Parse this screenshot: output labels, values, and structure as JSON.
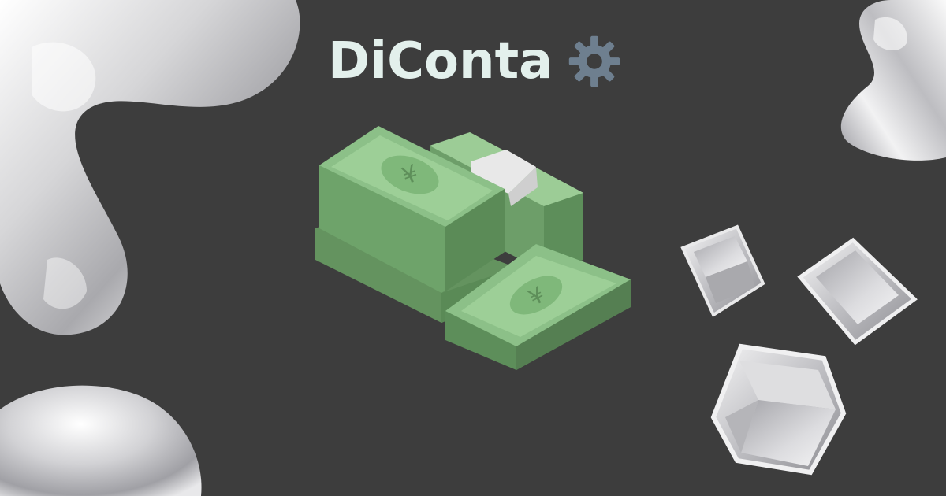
{
  "brand": {
    "name": "DiConta",
    "icon": "gear-icon"
  },
  "illustration": {
    "subject": "money-stacks-icon",
    "currency_symbol": "¥",
    "bill_color": "#7fb87a",
    "band_color": "#e6e6e6"
  },
  "decor": {
    "shapes": [
      "liquid-metal-blob",
      "metal-cube"
    ],
    "background": "#3d3d3d"
  }
}
